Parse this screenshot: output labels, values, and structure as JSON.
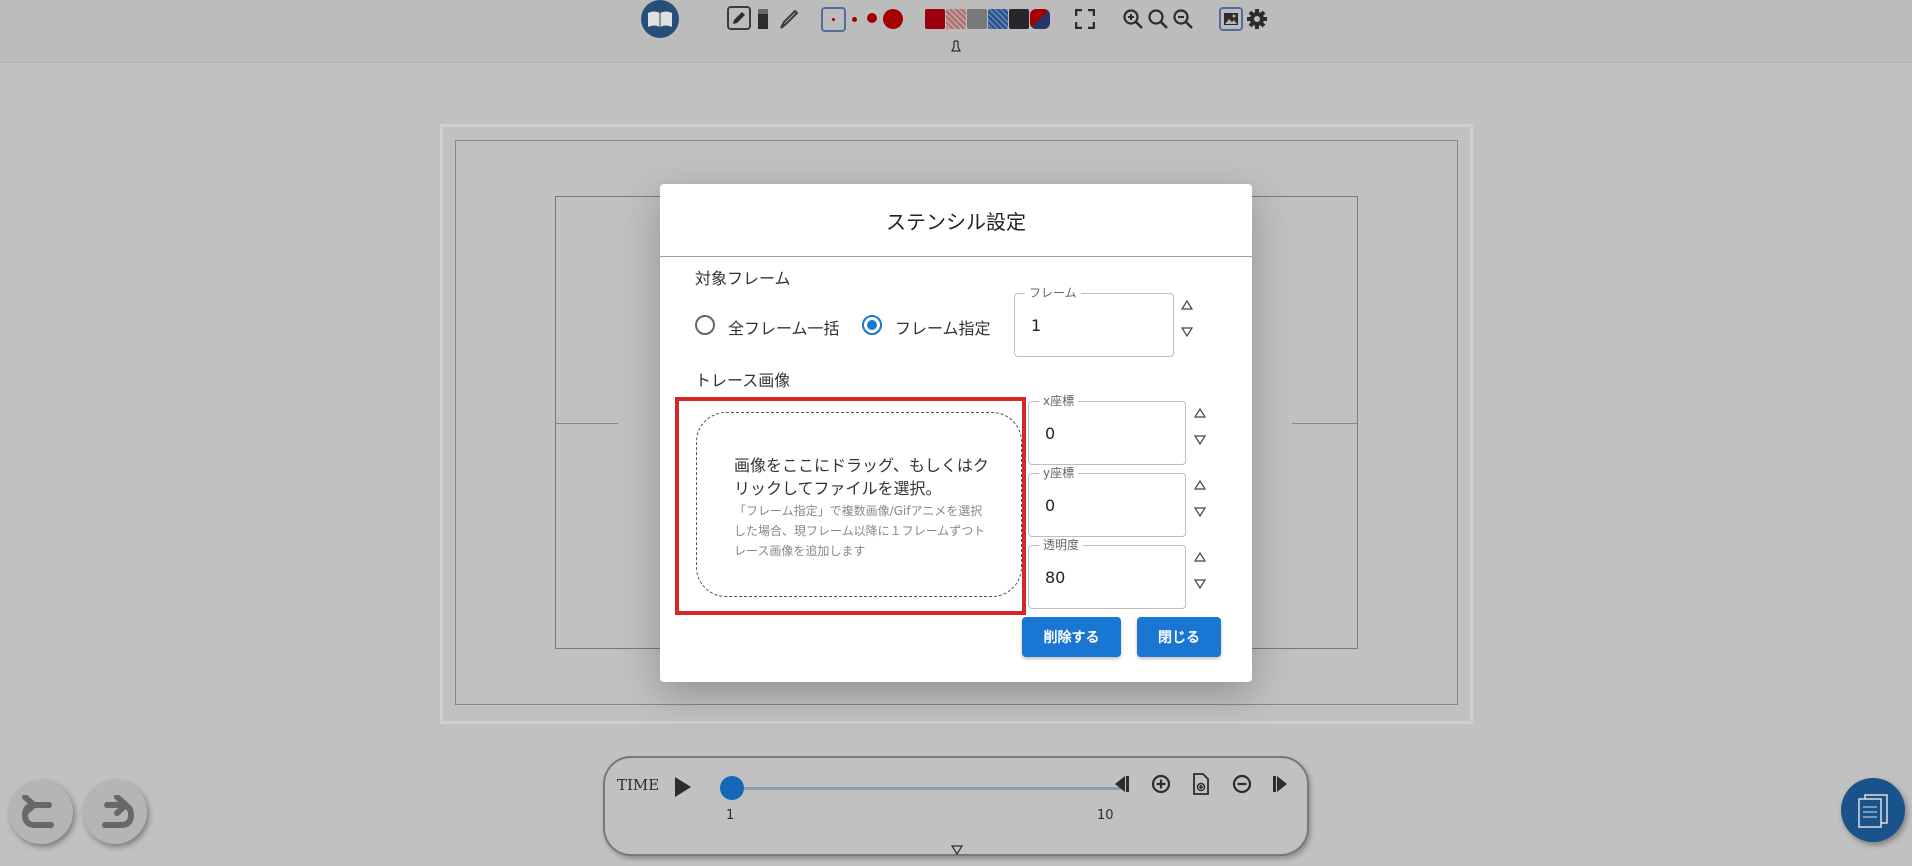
{
  "timeline": {
    "label": "TIME",
    "start_tick": "1",
    "end_tick": "10",
    "current_frame": 1,
    "total_frames": 10
  },
  "dialog": {
    "title": "ステンシル設定",
    "target_frame_heading": "対象フレーム",
    "radio_all": "全フレーム一括",
    "radio_specific": "フレーム指定",
    "frame_field": {
      "label": "フレーム",
      "value": "1"
    },
    "trace_heading": "トレース画像",
    "dropzone": {
      "main": "画像をここにドラッグ、もしくはクリックしてファイルを選択。",
      "sub": "「フレーム指定」で複数画像/Gifアニメを選択した場合、現フレーム以降に１フレームずつトレース画像を追加します"
    },
    "x_field": {
      "label": "x座標",
      "value": "0"
    },
    "y_field": {
      "label": "y座標",
      "value": "0"
    },
    "opacity_field": {
      "label": "透明度",
      "value": "80"
    },
    "delete_button": "削除する",
    "close_button": "閉じる"
  },
  "colors": {
    "accent": "#1976d2",
    "highlight": "#d62727",
    "toolbar_bg": "#d6d6d6"
  },
  "icons": [
    "book-icon",
    "pen-icon",
    "eraser-icon",
    "brush-icon",
    "small-dot-icon",
    "medium-dot-icon",
    "large-dot-icon",
    "palette-icon",
    "fullscreen-icon",
    "zoom-in-icon",
    "zoom-reset-icon",
    "zoom-out-icon",
    "image-icon",
    "gear-icon",
    "play-icon",
    "undo-icon",
    "redo-icon",
    "notebook-icon"
  ]
}
